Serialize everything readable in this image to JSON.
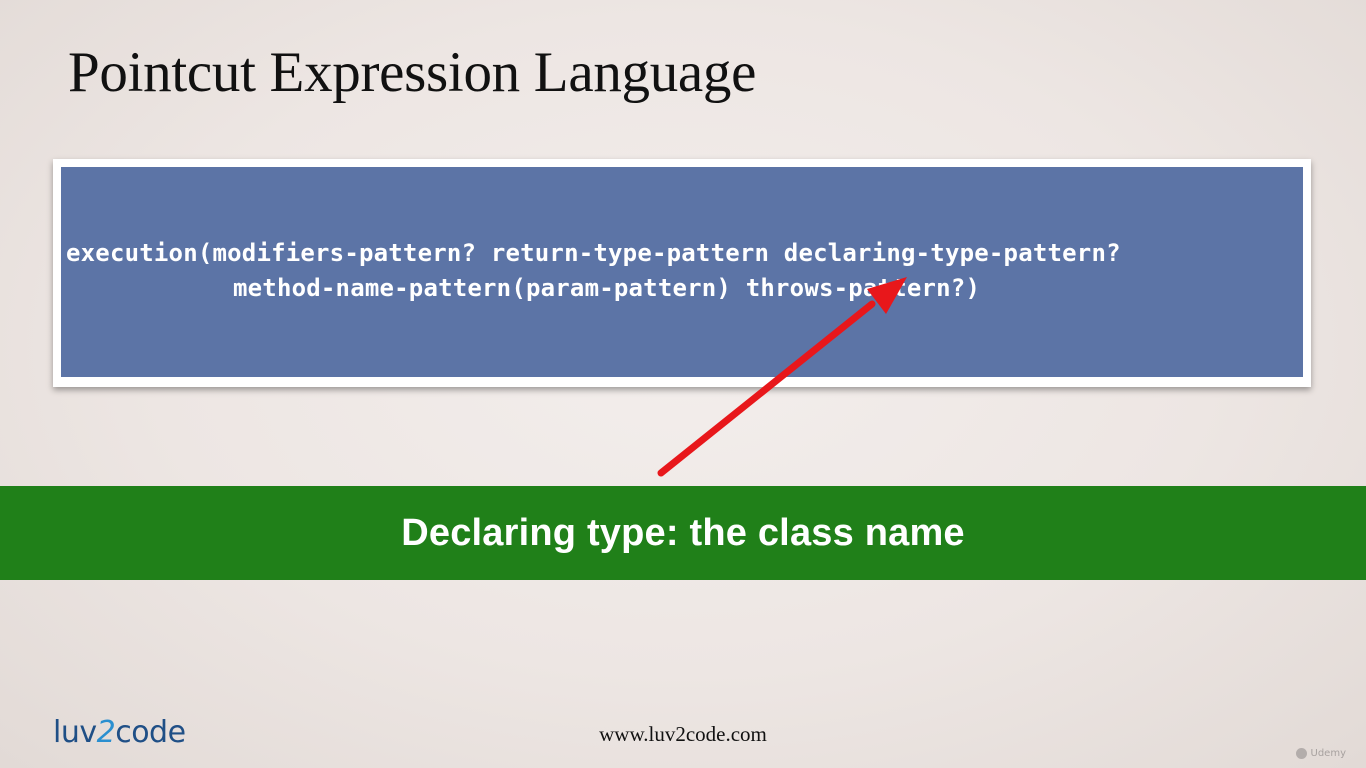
{
  "slide": {
    "title": "Pointcut Expression Language"
  },
  "code": {
    "line1": "execution(modifiers-pattern? return-type-pattern declaring-type-pattern?",
    "line2": "method-name-pattern(param-pattern) throws-pattern?)"
  },
  "banner": {
    "text": "Declaring type: the class name",
    "color": "#208019"
  },
  "arrow": {
    "color": "#e8171b",
    "icon": "arrow-icon"
  },
  "footer": {
    "logo_prefix": "luv",
    "logo_digit": "2",
    "logo_suffix": "code",
    "url": "www.luv2code.com"
  },
  "watermark": {
    "text": "Udemy"
  }
}
